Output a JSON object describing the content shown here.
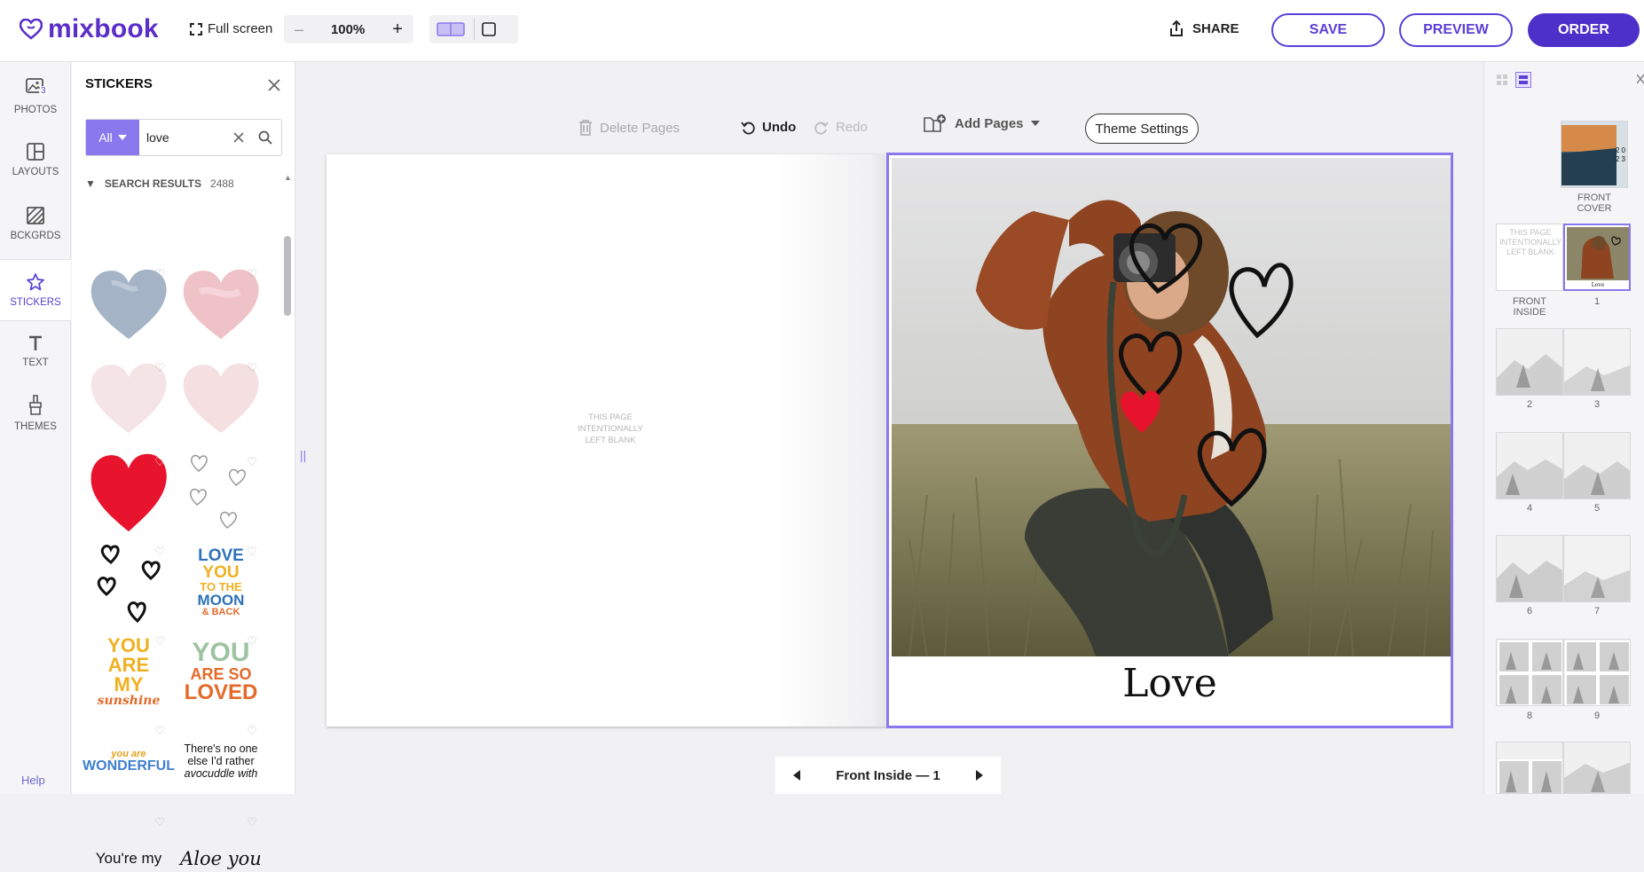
{
  "app": {
    "name": "mixbook"
  },
  "toolbar": {
    "fullscreen": "Full screen",
    "zoom_minus": "–",
    "zoom": "100%",
    "zoom_plus": "+",
    "share": "SHARE",
    "save": "SAVE",
    "preview": "PREVIEW",
    "order": "ORDER"
  },
  "rail": {
    "items": [
      {
        "label": "PHOTOS",
        "badge": "3"
      },
      {
        "label": "LAYOUTS"
      },
      {
        "label": "BCKGRDS"
      },
      {
        "label": "STICKERS"
      },
      {
        "label": "TEXT"
      },
      {
        "label": "THEMES"
      }
    ],
    "help": "Help"
  },
  "panel": {
    "title": "STICKERS",
    "filter": "All",
    "query": "love",
    "results_label": "SEARCH RESULTS",
    "results_count": "2488",
    "text_stickers": {
      "love_moon": [
        "LOVE",
        "YOU",
        "TO THE",
        "MOON",
        "& BACK"
      ],
      "sunshine": [
        "YOU",
        "ARE",
        "MY",
        "sunshine"
      ],
      "so_loved": [
        "YOU",
        "ARE SO",
        "LOVED"
      ],
      "wonderful": [
        "you are",
        "WONDERFUL"
      ],
      "avocuddle": [
        "There's no one",
        "else I'd rather",
        "avocuddle with"
      ],
      "youre_my": "You're my",
      "aloe": "Aloe you"
    }
  },
  "editor": {
    "delete_pages": "Delete Pages",
    "undo": "Undo",
    "redo": "Redo",
    "add_pages": "Add Pages",
    "theme_settings": "Theme Settings",
    "blank_page_text": [
      "THIS PAGE",
      "INTENTIONALLY",
      "LEFT BLANK"
    ],
    "caption": "Love",
    "pager_label": "Front Inside — 1"
  },
  "thumbnails": {
    "front_cover": "FRONT COVER",
    "cover_year": [
      "2 0",
      "2 3"
    ],
    "front_inside": "FRONT INSIDE",
    "blank_text": [
      "THIS PAGE",
      "INTENTIONALLY",
      "LEFT BLANK"
    ],
    "spread_page_caption": "Love",
    "page_labels": [
      "1",
      "2",
      "3",
      "4",
      "5",
      "6",
      "7",
      "8",
      "9"
    ]
  },
  "colors": {
    "accent": "#5b3fd6",
    "accent_light": "#8a78ee",
    "heart_red": "#e8132d"
  }
}
